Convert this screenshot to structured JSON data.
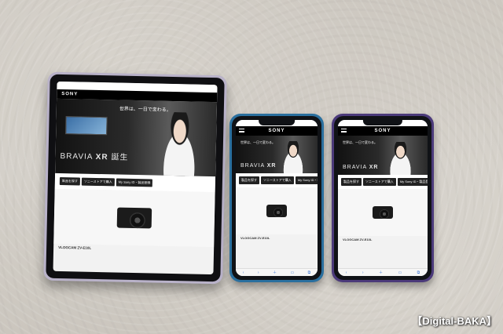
{
  "scene": {
    "watermark": "【Digital-BAKA】"
  },
  "page": {
    "brand": "SONY",
    "tagline": "世界は、一日で変わる。",
    "product_prefix": "BRAVIA",
    "product_suffix": "XR",
    "subline": "誕生",
    "tabs": [
      "製品を探す",
      "ソニーストアで購入",
      "My Sony ID・製品登録"
    ],
    "caption": "VLOGCAM ZV-E10L"
  },
  "devices": [
    {
      "name": "ipad-mini",
      "frame_color": "#b9b2c9"
    },
    {
      "name": "iphone-blue",
      "frame_color": "#2a6f9e"
    },
    {
      "name": "iphone-purple",
      "frame_color": "#4b3a7a"
    }
  ],
  "colors": {
    "navbar": "#000000",
    "tab": "#222222",
    "safari_blue": "#4a7fd6"
  }
}
